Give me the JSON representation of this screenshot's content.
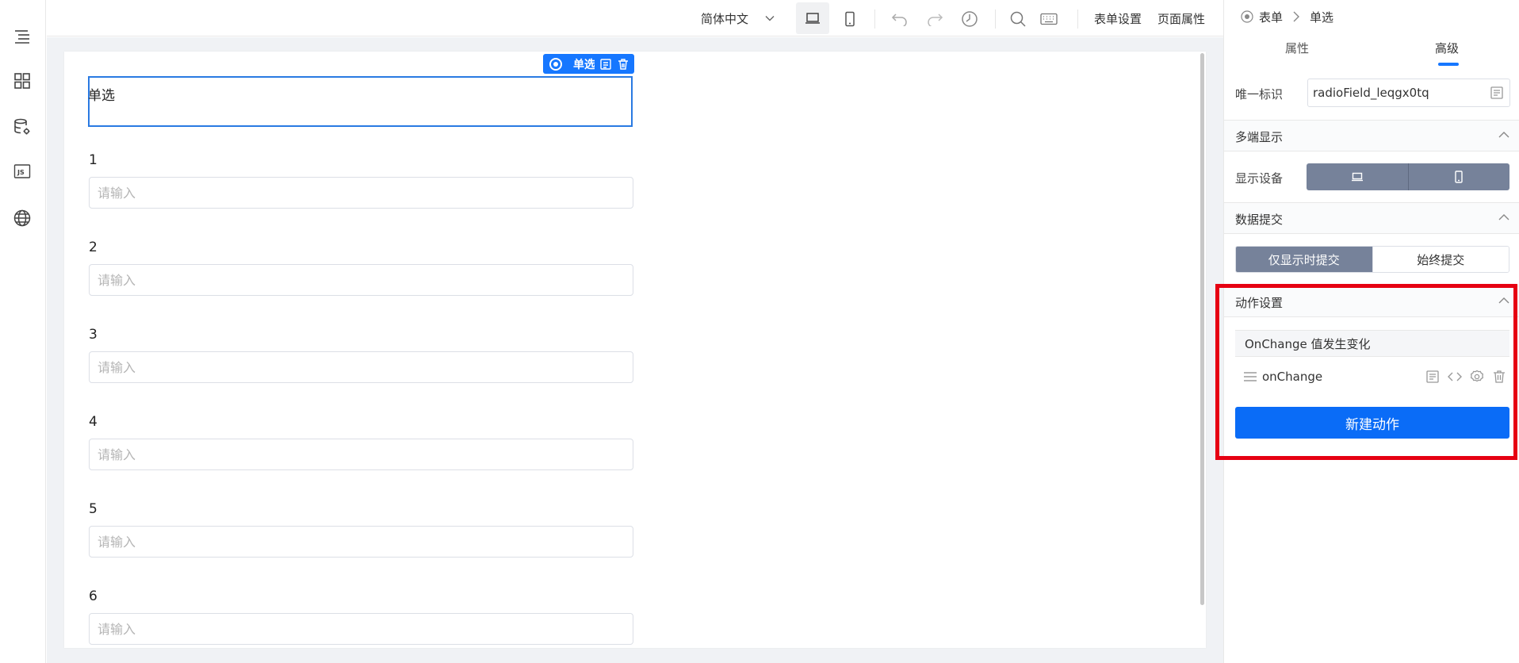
{
  "toolbar": {
    "language": "简体中文",
    "form_settings": "表单设置",
    "page_properties": "页面属性"
  },
  "canvas": {
    "selected_component": {
      "label": "单选",
      "tag_label": "单选"
    },
    "fields": [
      {
        "label": "1",
        "placeholder": "请输入"
      },
      {
        "label": "2",
        "placeholder": "请输入"
      },
      {
        "label": "3",
        "placeholder": "请输入"
      },
      {
        "label": "4",
        "placeholder": "请输入"
      },
      {
        "label": "5",
        "placeholder": "请输入"
      },
      {
        "label": "6",
        "placeholder": "请输入"
      }
    ]
  },
  "panel": {
    "breadcrumb": [
      "表单",
      "单选"
    ],
    "tabs": [
      "属性",
      "高级"
    ],
    "active_tab": "高级",
    "unique_id_label": "唯一标识",
    "unique_id_value": "radioField_leqgx0tq",
    "multi_display": {
      "title": "多端显示",
      "device_label": "显示设备"
    },
    "data_submit": {
      "title": "数据提交",
      "options": [
        "仅显示时提交",
        "始终提交"
      ],
      "selected": "仅显示时提交"
    },
    "actions": {
      "title": "动作设置",
      "event_title": "OnChange 值发生变化",
      "handler_name": "onChange",
      "new_button": "新建动作"
    }
  },
  "colors": {
    "primary": "#1677ff",
    "toggle_active": "#76829a",
    "highlight": "#e60012"
  }
}
